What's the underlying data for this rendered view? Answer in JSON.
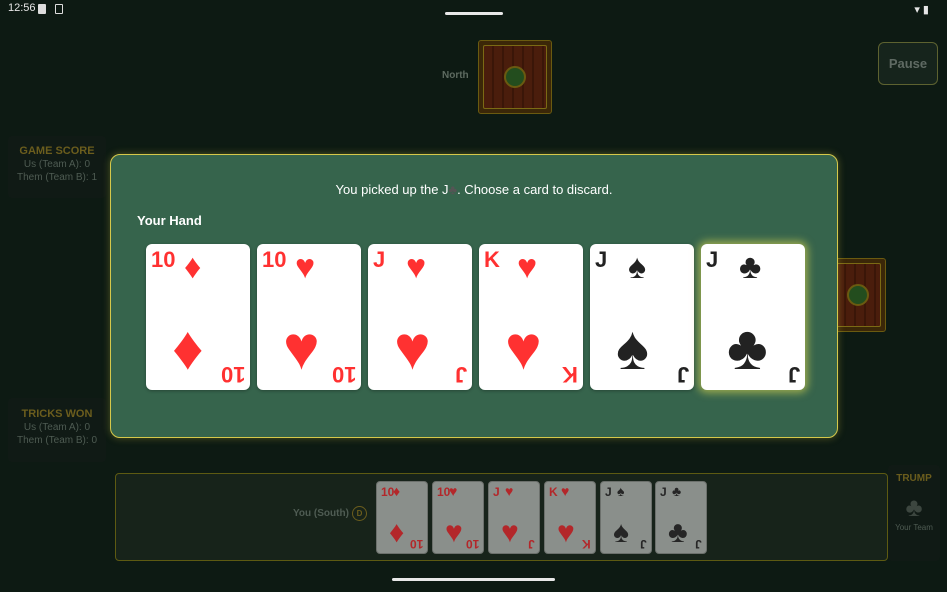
{
  "status": {
    "time": "12:56"
  },
  "north": {
    "label": "North"
  },
  "pause": {
    "label": "Pause"
  },
  "game_score": {
    "title": "GAME SCORE",
    "us": "Us (Team A): 0",
    "them": "Them (Team B): 1"
  },
  "tricks_won": {
    "title": "TRICKS WON",
    "us": "Us (Team A): 0",
    "them": "Them (Team B): 0"
  },
  "south": {
    "label": "You (South)",
    "dealer_chip": "D"
  },
  "trump": {
    "title": "TRUMP",
    "suit_icon": "♣",
    "team": "Your Team"
  },
  "modal": {
    "message_prefix": "You picked up the J",
    "message_suit": "♣",
    "message_suffix": ". Choose a card to discard.",
    "hand_title": "Your Hand",
    "cards": [
      {
        "rank": "10",
        "suit": "♦",
        "color": "red"
      },
      {
        "rank": "10",
        "suit": "♥",
        "color": "red"
      },
      {
        "rank": "J",
        "suit": "♥",
        "color": "red"
      },
      {
        "rank": "K",
        "suit": "♥",
        "color": "red"
      },
      {
        "rank": "J",
        "suit": "♠",
        "color": "black"
      },
      {
        "rank": "J",
        "suit": "♣",
        "color": "black"
      }
    ]
  },
  "hand": [
    {
      "rank": "10",
      "suit": "♦"
    },
    {
      "rank": "10",
      "suit": "♥"
    },
    {
      "rank": "J",
      "suit": "♥"
    },
    {
      "rank": "K",
      "suit": "♥"
    },
    {
      "rank": "J",
      "suit": "♠"
    },
    {
      "rank": "J",
      "suit": "♣"
    }
  ],
  "colors": {
    "red_suit": "#ff3131",
    "black_suit": "#222222",
    "felt": "#36644c",
    "accent": "#d6c84a"
  }
}
